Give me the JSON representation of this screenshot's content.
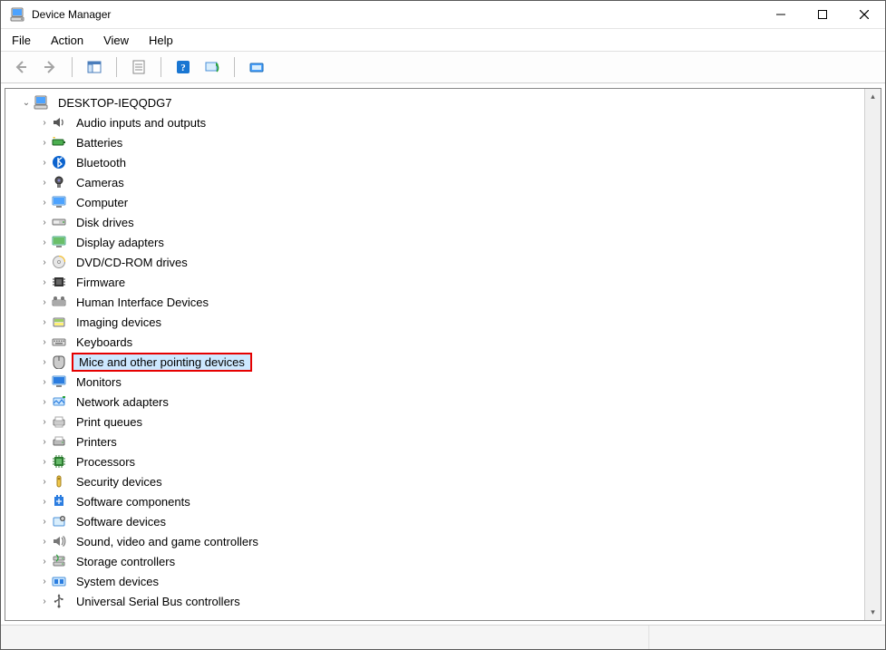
{
  "window": {
    "title": "Device Manager"
  },
  "menu": {
    "file": "File",
    "action": "Action",
    "view": "View",
    "help": "Help"
  },
  "tree": {
    "root": "DESKTOP-IEQQDG7",
    "items": [
      {
        "label": "Audio inputs and outputs",
        "icon": "speaker"
      },
      {
        "label": "Batteries",
        "icon": "battery"
      },
      {
        "label": "Bluetooth",
        "icon": "bluetooth"
      },
      {
        "label": "Cameras",
        "icon": "camera"
      },
      {
        "label": "Computer",
        "icon": "monitor"
      },
      {
        "label": "Disk drives",
        "icon": "disk"
      },
      {
        "label": "Display adapters",
        "icon": "display"
      },
      {
        "label": "DVD/CD-ROM drives",
        "icon": "cd"
      },
      {
        "label": "Firmware",
        "icon": "chip"
      },
      {
        "label": "Human Interface Devices",
        "icon": "hid"
      },
      {
        "label": "Imaging devices",
        "icon": "imaging"
      },
      {
        "label": "Keyboards",
        "icon": "keyboard"
      },
      {
        "label": "Mice and other pointing devices",
        "icon": "mouse",
        "highlight": true
      },
      {
        "label": "Monitors",
        "icon": "monitor2"
      },
      {
        "label": "Network adapters",
        "icon": "network"
      },
      {
        "label": "Print queues",
        "icon": "printqueue"
      },
      {
        "label": "Printers",
        "icon": "printer"
      },
      {
        "label": "Processors",
        "icon": "cpu"
      },
      {
        "label": "Security devices",
        "icon": "security"
      },
      {
        "label": "Software components",
        "icon": "swcomponent"
      },
      {
        "label": "Software devices",
        "icon": "swdevice"
      },
      {
        "label": "Sound, video and game controllers",
        "icon": "sound"
      },
      {
        "label": "Storage controllers",
        "icon": "storage"
      },
      {
        "label": "System devices",
        "icon": "system"
      },
      {
        "label": "Universal Serial Bus controllers",
        "icon": "usb"
      }
    ]
  }
}
